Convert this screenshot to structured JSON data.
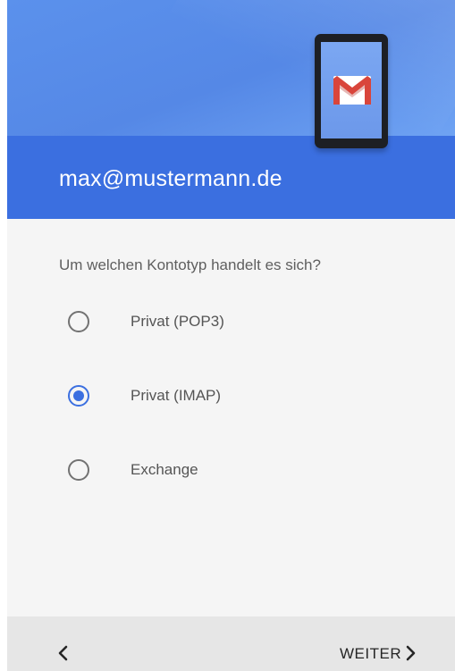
{
  "header": {
    "email": "max@mustermann.de",
    "illustration_icon": "gmail-device-icon"
  },
  "account_type": {
    "question": "Um welchen Kontotyp handelt es sich?",
    "options": [
      {
        "label": "Privat (POP3)",
        "selected": false
      },
      {
        "label": "Privat (IMAP)",
        "selected": true
      },
      {
        "label": "Exchange",
        "selected": false
      }
    ]
  },
  "footer": {
    "back_icon": "chevron-left-icon",
    "next_label": "WEITER",
    "next_icon": "chevron-right-icon"
  },
  "colors": {
    "primary": "#3b6fe0",
    "header_light": "#5b91ec",
    "background": "#f5f5f5",
    "footer": "#e6e6e6"
  }
}
